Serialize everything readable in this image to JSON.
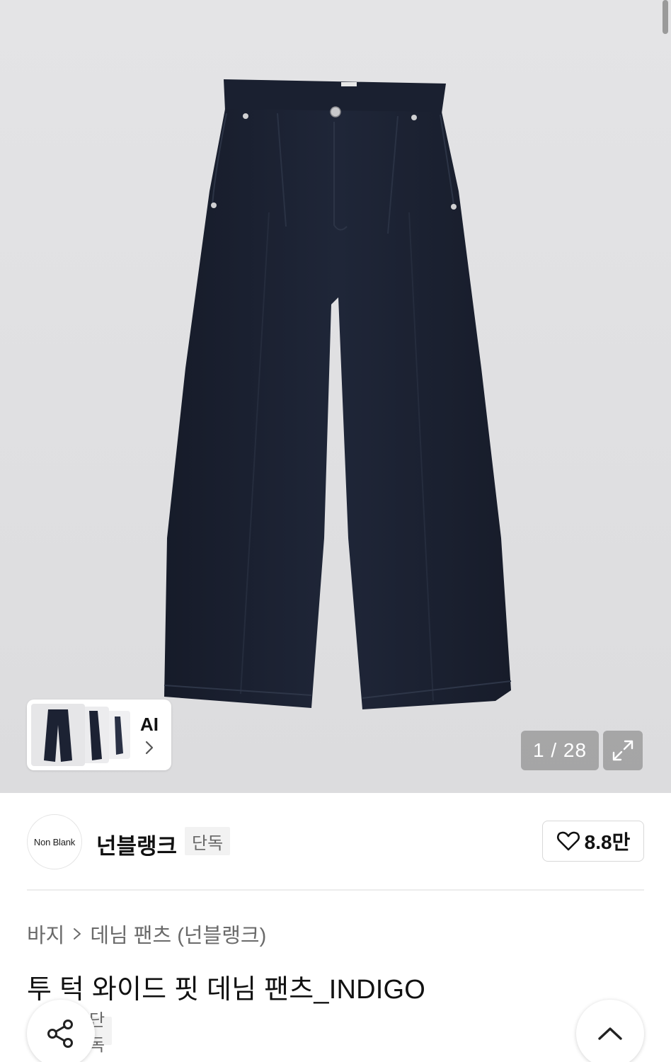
{
  "gallery": {
    "counter": "1 / 28",
    "ai_label": "AI"
  },
  "brand": {
    "logo_text": "Non Blank",
    "name": "넌블랭크",
    "badge": "단독",
    "likes": "8.8만"
  },
  "breadcrumb": {
    "items": [
      "바지",
      "데님 팬츠 (넌블랭크)"
    ]
  },
  "product": {
    "title": "투 턱 와이드 핏 데님 팬츠_INDIGO",
    "tag": "단독"
  },
  "icons": {
    "like": "heart-icon",
    "expand": "expand-icon",
    "share": "share-icon",
    "top": "chevron-up-icon",
    "ai": "chevron-right-icon",
    "breadcrumb_sep": "chevron-right-icon"
  },
  "colors": {
    "denim": "#1c2233",
    "hero_bg": "#e0e0e2",
    "badge_bg": "#f2f2f2"
  }
}
